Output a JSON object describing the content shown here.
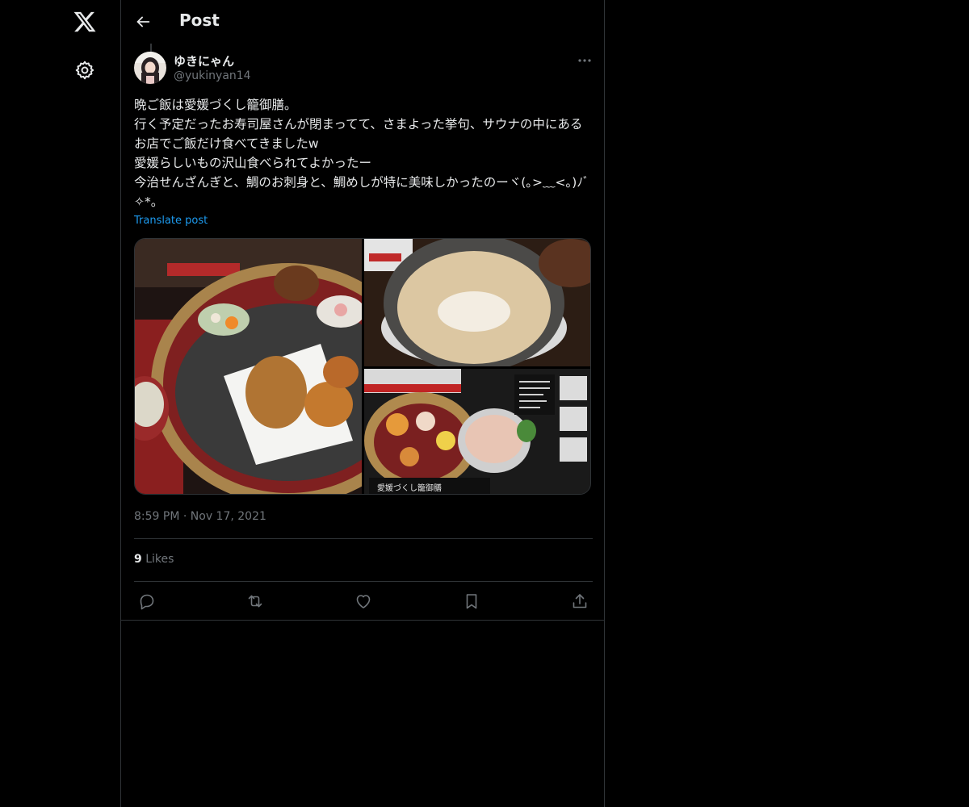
{
  "nav": {
    "logo_icon": "x-logo-icon",
    "settings_icon": "gear-icon"
  },
  "header": {
    "back_icon": "arrow-left-icon",
    "title": "Post"
  },
  "post": {
    "author_name": "ゆきにゃん",
    "author_handle": "@yukinyan14",
    "text": "晩ご飯は愛媛づくし籠御膳。\n行く予定だったお寿司屋さんが閉まってて、さまよった挙句、サウナの中にあるお店でご飯だけ食べてきましたw\n愛媛らしいもの沢山食べられてよかったー\n今治せんざんぎと、鯛のお刺身と、鯛めしが特に美味しかったのーヾ(｡>﹏<｡)ﾉﾞ✧*。",
    "translate_label": "Translate post",
    "time": "8:59 PM",
    "separator": "·",
    "date": "Nov 17, 2021",
    "likes_count": "9",
    "likes_label": "Likes",
    "media_caption": "愛媛づくし籠御膳"
  },
  "actions": [
    {
      "name": "reply-button",
      "icon": "reply-icon"
    },
    {
      "name": "repost-button",
      "icon": "repost-icon"
    },
    {
      "name": "like-button",
      "icon": "heart-icon"
    },
    {
      "name": "bookmark-button",
      "icon": "bookmark-icon"
    },
    {
      "name": "share-button",
      "icon": "share-icon"
    }
  ],
  "colors": {
    "background": "#000000",
    "text": "#e7e9ea",
    "muted": "#71767b",
    "link": "#1d9bf0",
    "border": "#2f3336"
  }
}
